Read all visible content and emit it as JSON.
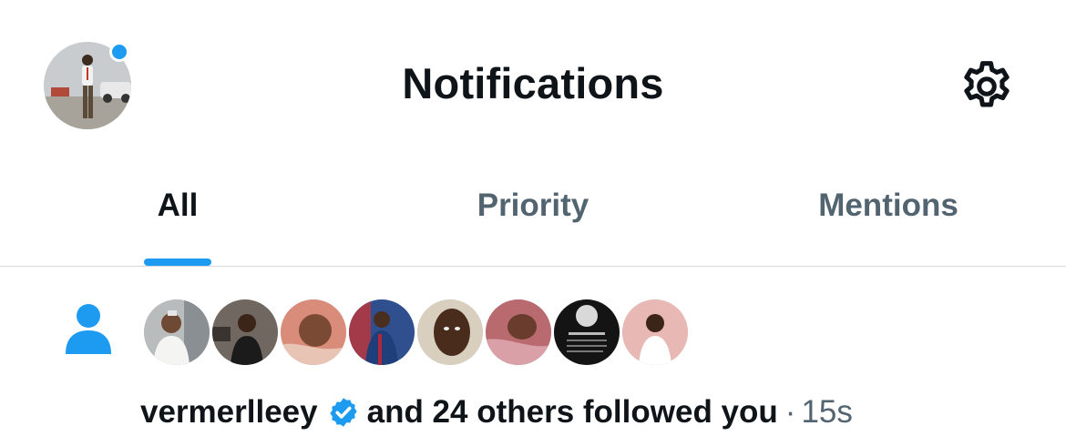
{
  "header": {
    "title": "Notifications",
    "avatar_icon": "profile-avatar",
    "settings_icon": "gear-icon"
  },
  "tabs": [
    {
      "label": "All",
      "active": true
    },
    {
      "label": "Priority",
      "active": false
    },
    {
      "label": "Mentions",
      "active": false
    }
  ],
  "notification": {
    "icon": "person-icon",
    "user": "vermerlleey",
    "verified": true,
    "text": "and 24 others followed you",
    "separator": "·",
    "time": "15s",
    "follower_avatar_count": 8
  },
  "colors": {
    "accent": "#1d9bf0",
    "text_primary": "#0f1419",
    "text_secondary": "#536471",
    "divider": "#d4d8db"
  }
}
